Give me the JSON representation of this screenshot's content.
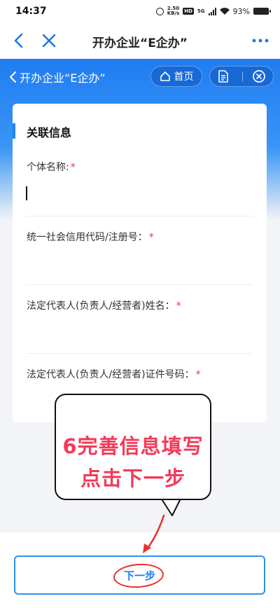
{
  "status_bar": {
    "time": "14:37",
    "net_speed_value": "2.50",
    "net_speed_unit": "KB/s",
    "hd_label": "HD",
    "network": "5G",
    "battery": "93%"
  },
  "nav": {
    "title": "开办企业“E企办”"
  },
  "header": {
    "back_label": "开办企业“E企办”",
    "home_label": "首页"
  },
  "form": {
    "section_title": "关联信息",
    "fields": [
      {
        "label": "个体名称:",
        "required": "*"
      },
      {
        "label": "统一社会信用代码/注册号：",
        "required": "*"
      },
      {
        "label": "法定代表人(负责人/经营者)姓名：",
        "required": "*"
      },
      {
        "label": "法定代表人(负责人/经营者)证件号码：",
        "required": "*"
      }
    ]
  },
  "annotation": {
    "line1": "6完善信息填写",
    "line2": "点击下一步",
    "color": "#f23a5a"
  },
  "footer": {
    "next_label": "下一步"
  },
  "colors": {
    "primary_blue": "#1f7df2",
    "button_border": "#2f8ff2",
    "required_red": "#e53b3b",
    "mark_red": "#e8302e"
  }
}
